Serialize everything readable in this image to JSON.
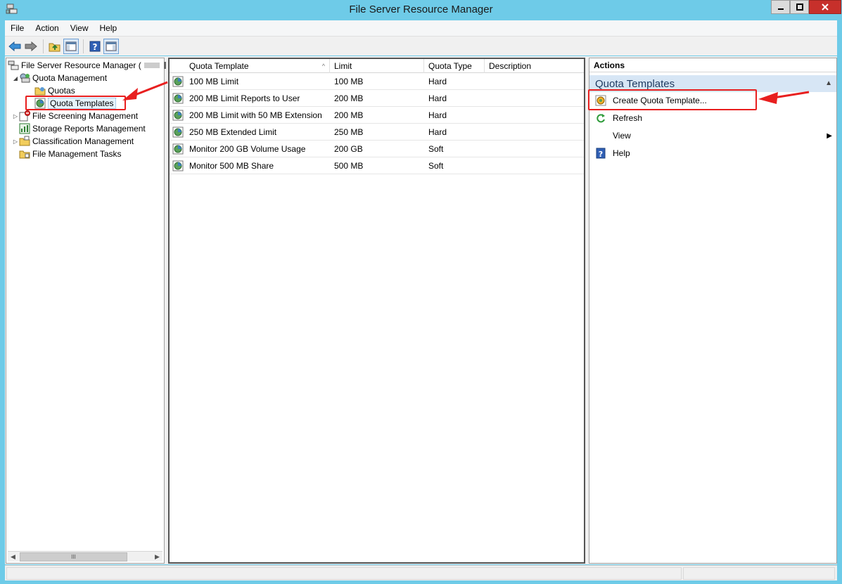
{
  "window": {
    "title": "File Server Resource Manager",
    "controls": {
      "minimize": "▁",
      "maximize": "□",
      "close": "✕"
    }
  },
  "menubar": [
    "File",
    "Action",
    "View",
    "Help"
  ],
  "tree": {
    "root": "File Server Resource Manager (",
    "items": [
      {
        "label": "Quota Management",
        "expander": "◢"
      },
      {
        "label": "Quotas"
      },
      {
        "label": "Quota Templates",
        "selected": true
      },
      {
        "label": "File Screening Management",
        "expander": "▷"
      },
      {
        "label": "Storage Reports Management"
      },
      {
        "label": "Classification Management",
        "expander": "▷"
      },
      {
        "label": "File Management Tasks"
      }
    ],
    "scroll_thumb": "III"
  },
  "list": {
    "columns": [
      "Quota Template",
      "Limit",
      "Quota Type",
      "Description"
    ],
    "sort_indicator": "^",
    "rows": [
      {
        "name": "100 MB Limit",
        "limit": "100 MB",
        "type": "Hard",
        "description": ""
      },
      {
        "name": "200 MB Limit Reports to User",
        "limit": "200 MB",
        "type": "Hard",
        "description": ""
      },
      {
        "name": "200 MB Limit with 50 MB Extension",
        "limit": "200 MB",
        "type": "Hard",
        "description": ""
      },
      {
        "name": "250 MB Extended Limit",
        "limit": "250 MB",
        "type": "Hard",
        "description": ""
      },
      {
        "name": "Monitor 200 GB Volume Usage",
        "limit": "200 GB",
        "type": "Soft",
        "description": ""
      },
      {
        "name": "Monitor 500 MB Share",
        "limit": "500 MB",
        "type": "Soft",
        "description": ""
      }
    ]
  },
  "actions": {
    "header": "Actions",
    "section": "Quota Templates",
    "items": [
      "Create Quota Template...",
      "Refresh",
      "View",
      "Help"
    ]
  },
  "colors": {
    "titlebar": "#6ecbe8",
    "highlight_red": "#e81f1f",
    "section_bg": "#d7e6f5"
  }
}
